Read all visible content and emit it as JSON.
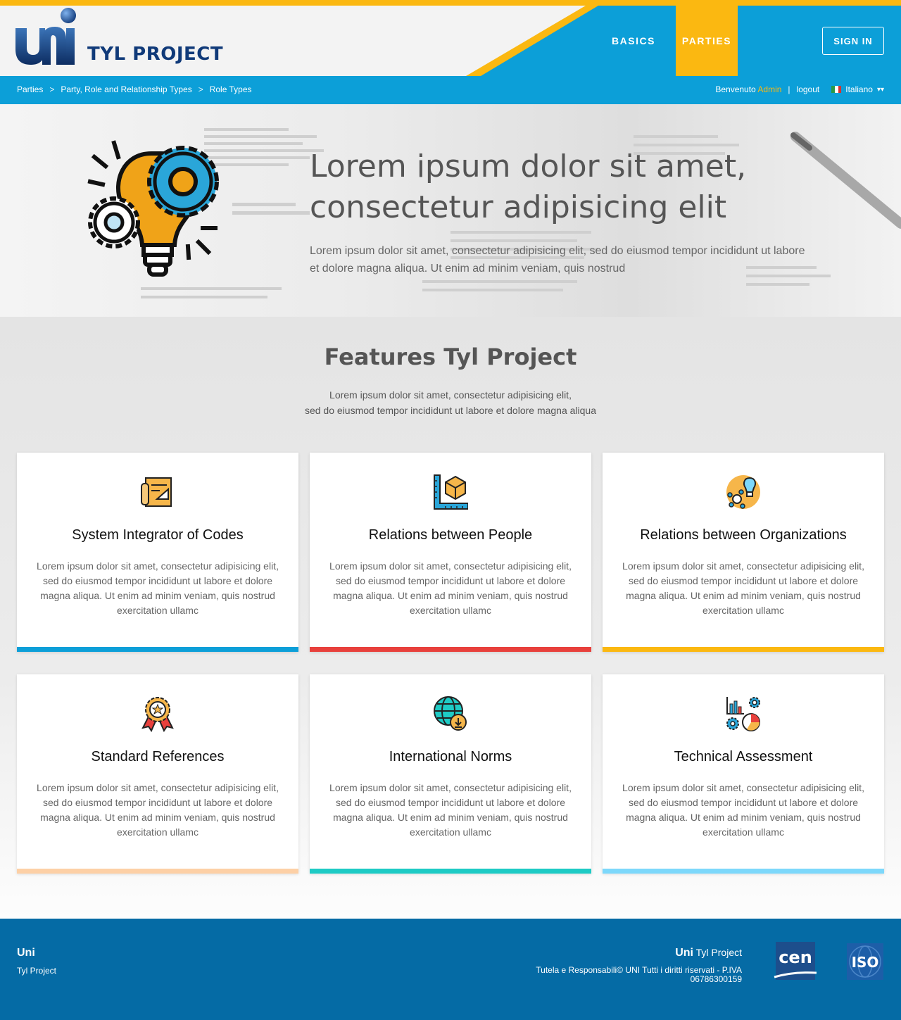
{
  "header": {
    "brand": "TYL PROJECT",
    "nav": {
      "basics": "BASICS",
      "parties": "PARTIES"
    },
    "sign_in": "SIGN IN"
  },
  "subbar": {
    "breadcrumb": [
      "Parties",
      "Party, Role and Relationship Types",
      "Role Types"
    ],
    "separator": ">",
    "welcome": "Benvenuto",
    "user": "Admin",
    "divider": "|",
    "logout": "logout",
    "language": "Italiano"
  },
  "hero": {
    "title": "Lorem ipsum dolor sit amet, consectetur adipisicing elit",
    "subtitle": "Lorem ipsum dolor sit amet, consectetur adipisicing elit, sed do eiusmod tempor incididunt ut labore et dolore magna aliqua. Ut enim ad minim veniam, quis nostrud"
  },
  "features": {
    "title": "Features Tyl Project",
    "subtitle_line1": "Lorem ipsum dolor sit amet, consectetur adipisicing elit,",
    "subtitle_line2": "sed do eiusmod tempor incididunt ut labore et dolore magna aliqua",
    "cards": [
      {
        "title": "System Integrator of Codes",
        "text": "Lorem ipsum dolor sit amet, consectetur adipisicing elit, sed do eiusmod tempor incididunt ut labore et dolore magna aliqua. Ut enim ad minim veniam, quis nostrud exercitation ullamc",
        "icon": "blueprint-icon",
        "accent": "#0c9fd8"
      },
      {
        "title": "Relations between People",
        "text": "Lorem ipsum dolor sit amet, consectetur adipisicing elit, sed do eiusmod tempor incididunt ut labore et dolore magna aliqua. Ut enim ad minim veniam, quis nostrud exercitation ullamc",
        "icon": "ruler-cube-icon",
        "accent": "#e8403c"
      },
      {
        "title": "Relations between Organizations",
        "text": "Lorem ipsum dolor sit amet, consectetur adipisicing elit, sed do eiusmod tempor incididunt ut labore et dolore magna aliqua. Ut enim ad minim veniam, quis nostrud exercitation ullamc",
        "icon": "idea-network-icon",
        "accent": "#fbb811"
      },
      {
        "title": "Standard References",
        "text": "Lorem ipsum dolor sit amet, consectetur adipisicing elit, sed do eiusmod tempor incididunt ut labore et dolore magna aliqua. Ut enim ad minim veniam, quis nostrud exercitation ullamc",
        "icon": "award-badge-icon",
        "accent": "#fdd0a6"
      },
      {
        "title": "International Norms",
        "text": "Lorem ipsum dolor sit amet, consectetur adipisicing elit, sed do eiusmod tempor incididunt ut labore et dolore magna aliqua. Ut enim ad minim veniam, quis nostrud exercitation ullamc",
        "icon": "globe-download-icon",
        "accent": "#1ecbc5"
      },
      {
        "title": "Technical Assessment",
        "text": "Lorem ipsum dolor sit amet, consectetur adipisicing elit, sed do eiusmod tempor incididunt ut labore et dolore magna aliqua. Ut enim ad minim veniam, quis nostrud exercitation ullamc",
        "icon": "analytics-gears-icon",
        "accent": "#7dd8fb"
      }
    ]
  },
  "footer": {
    "uni": "Uni",
    "tyl": "Tyl Project",
    "right_uni": "Uni",
    "right_tyl": "Tyl Project",
    "copy_line1": "Tutela e Responsabili© UNI Tutti i diritti riservati - P.IVA",
    "copy_line2": "06786300159"
  },
  "colors": {
    "yellow": "#fbb811",
    "blue": "#0c9fd8",
    "navy": "#103a79",
    "footer": "#056ba5"
  }
}
